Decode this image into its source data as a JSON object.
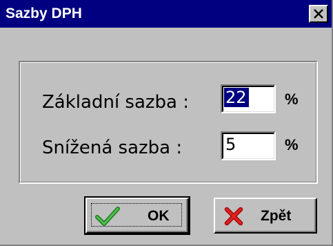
{
  "window": {
    "title": "Sazby DPH"
  },
  "form": {
    "basic_rate": {
      "label": "Základní sazba :",
      "value": "22",
      "unit": "%"
    },
    "reduced_rate": {
      "label": "Snížená sazba :",
      "value": "5",
      "unit": "%"
    }
  },
  "buttons": {
    "ok_label": "OK",
    "back_label": "Zpět"
  },
  "icons": {
    "close": "close-icon",
    "ok": "checkmark-icon",
    "back": "cross-icon"
  },
  "colors": {
    "titlebar": "#000080",
    "selection": "#000080",
    "window": "#c0c0c0",
    "ok_check": "#2e9e2e",
    "back_cross": "#d01010"
  }
}
